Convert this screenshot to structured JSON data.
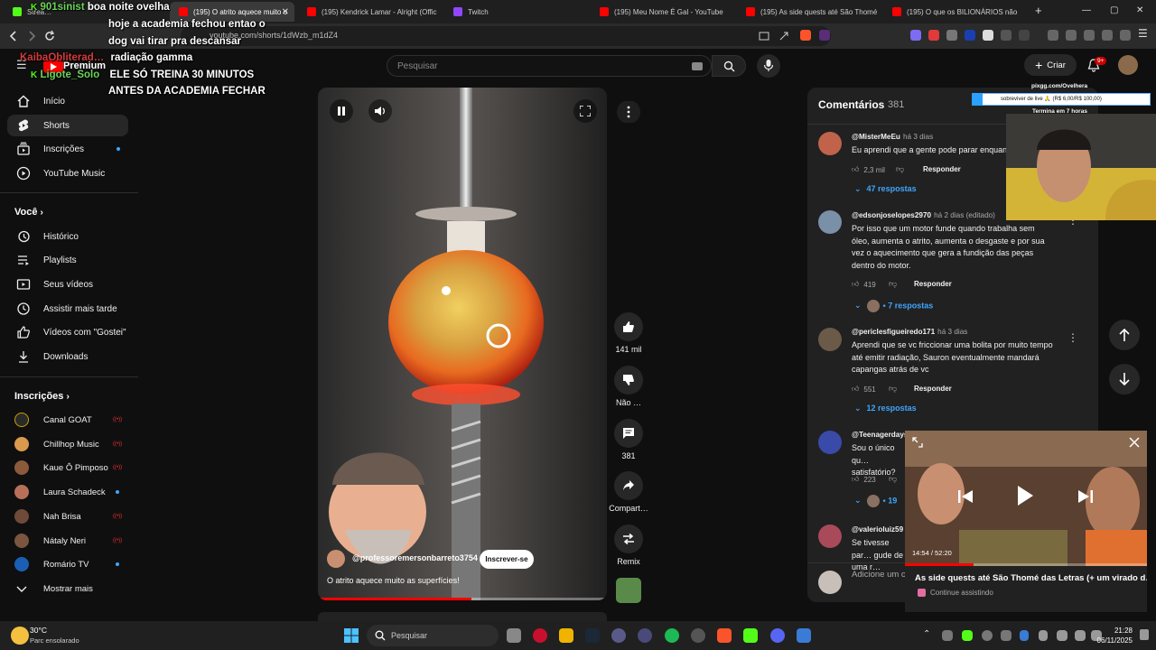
{
  "browser": {
    "tabs": [
      {
        "label": "Strea…",
        "fav_color": "#53fc18"
      },
      {
        "label": "(195) O atrito aquece muito o",
        "fav_color": "#ff0000",
        "active": true
      },
      {
        "label": "(195) Kendrick Lamar - Alright (Offic",
        "fav_color": "#ff0000"
      },
      {
        "label": "Twitch",
        "fav_color": "#9146ff"
      },
      {
        "label": "(195) Meu Nome É Gal - YouTube",
        "fav_color": "#ff0000"
      },
      {
        "label": "(195) As side quests até São Thomé",
        "fav_color": "#ff0000"
      },
      {
        "label": "(195) O que os BILIONÁRIOS não te",
        "fav_color": "#ff0000"
      }
    ],
    "url": "youtube.com/shorts/1dWzb_m1dZ4",
    "new_tab": "+",
    "win_min": "—",
    "win_max": "▢",
    "win_close": "✕"
  },
  "chat": [
    {
      "user": "901sinist",
      "text": "boa noite ovelha"
    },
    {
      "user": "",
      "text": "hoje a academia fechou entao o"
    },
    {
      "user": "",
      "text": "dog vai tirar pra descansar"
    },
    {
      "user": "KaibaObliterad…",
      "text": "radiação gamma"
    },
    {
      "user": "Ligote_Solo",
      "text": "ELE SÓ TREINA 30 MINUTOS"
    },
    {
      "user": "",
      "text": "ANTES DA ACADEMIA FECHAR"
    }
  ],
  "youtube": {
    "logo_text": "Premium",
    "search_placeholder": "Pesquisar",
    "create_label": "Criar",
    "notif_count": "9+",
    "nav": [
      {
        "label": "Início",
        "icon": "home-icon"
      },
      {
        "label": "Shorts",
        "icon": "shorts-icon",
        "selected": true
      },
      {
        "label": "Inscrições",
        "icon": "subscriptions-icon"
      },
      {
        "label": "YouTube Music",
        "icon": "music-icon"
      }
    ],
    "you_header": "Você",
    "you_items": [
      {
        "label": "Histórico",
        "icon": "history-icon"
      },
      {
        "label": "Playlists",
        "icon": "playlists-icon"
      },
      {
        "label": "Seus vídeos",
        "icon": "your-videos-icon"
      },
      {
        "label": "Assistir mais tarde",
        "icon": "watch-later-icon"
      },
      {
        "label": "Vídeos com \"Gostei\"",
        "icon": "liked-icon"
      },
      {
        "label": "Downloads",
        "icon": "download-icon"
      }
    ],
    "subs_header": "Inscrições",
    "subs": [
      {
        "label": "Canal GOAT",
        "color": "#c9a000",
        "status": "live"
      },
      {
        "label": "Chillhop Music",
        "color": "#d99a4e",
        "status": "live"
      },
      {
        "label": "Kaue Ô Pimposo",
        "color": "#8a5a3a",
        "status": "live"
      },
      {
        "label": "Laura Schadeck",
        "color": "#b86f5a",
        "status": "dot"
      },
      {
        "label": "Nah Brisa",
        "color": "#6e4a3a",
        "status": "live"
      },
      {
        "label": "Nátaly Neri",
        "color": "#7a5540",
        "status": "live"
      },
      {
        "label": "Romário TV",
        "color": "#1a5fb4",
        "status": "dot"
      }
    ],
    "show_more": "Mostrar mais"
  },
  "short": {
    "channel": "@professoremersonbarreto3754",
    "subscribe": "Inscrever-se",
    "title": "O atrito aquece muito as superfícies!",
    "progress": 0.53,
    "like_count": "141 mil",
    "dislike_label": "Não …",
    "comment_count": "381",
    "share_label": "Compart…",
    "remix_label": "Remix"
  },
  "comments": {
    "header": "Comentários",
    "count": "381",
    "items": [
      {
        "user": "@MisterMeEu",
        "ago": "há 3 dias",
        "text": "Eu aprendi que a gente pode parar enquanto tá",
        "likes": "2,3 mil",
        "replies": "47 respostas",
        "color": "#c0634a"
      },
      {
        "user": "@edsonjoselopes2970",
        "ago": "há 2 dias (editado)",
        "text": "Por isso que um motor funde quando trabalha sem óleo, aumenta o atrito, aumenta o desgaste e por sua vez o aquecimento que gera a fundição das peças dentro do motor.",
        "likes": "419",
        "replies": "7 respostas",
        "color": "#7a8fa8"
      },
      {
        "user": "@periclesfigueiredo171",
        "ago": "há 3 dias",
        "text": "Aprendi que se vc friccionar uma bolita por muito tempo até emitir radiação, Sauron eventualmente mandará capangas atrás de vc",
        "likes": "551",
        "replies": "12 respostas",
        "color": "#6b5a48"
      },
      {
        "user": "@Teenagerdays",
        "ago": "",
        "text": "Sou o único qu… satisfatório?",
        "likes": "223",
        "replies": "19",
        "color": "#3a4aa8"
      },
      {
        "user": "@valerioluiz59",
        "ago": "",
        "text": "Se tivesse par… gude de uma r…",
        "likes": "",
        "replies": "",
        "color": "#a84a5a"
      }
    ],
    "add_placeholder": "Adicione um c…",
    "reply_label": "Responder"
  },
  "stream": {
    "donation_site": "pixgg.com/Ovelhera",
    "donation_goal": "sobreviver de live 🙏 (R$ 6,00/R$ 100,00)",
    "donation_progress": 0.06,
    "timer": "Termina em 7 horas"
  },
  "miniplayer": {
    "title": "As side quests até São Thomé das Letras (+ um virado d…",
    "continue": "Continue assistindo",
    "time": "14:54 / 52:20"
  },
  "taskbar": {
    "weather_temp": "30°C",
    "weather_desc": "Parc ensolarado",
    "search": "Pesquisar",
    "time": "21:28",
    "date": "06/11/2025"
  }
}
